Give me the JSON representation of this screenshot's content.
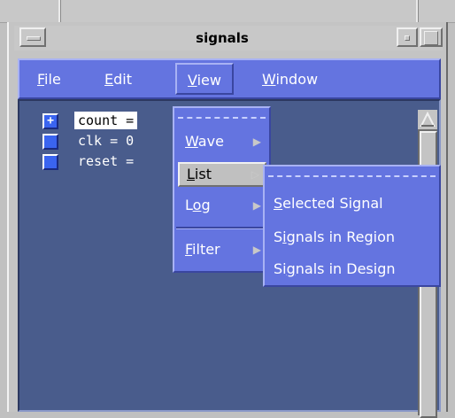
{
  "window": {
    "title": "signals"
  },
  "menubar": {
    "items": [
      {
        "mnemonic": "F",
        "rest": "ile"
      },
      {
        "mnemonic": "E",
        "rest": "dit"
      },
      {
        "mnemonic": "V",
        "rest": "iew"
      },
      {
        "mnemonic": "W",
        "rest": "indow"
      }
    ]
  },
  "signals": [
    {
      "text": "count =",
      "expand_symbol": "+"
    },
    {
      "text": "clk = 0"
    },
    {
      "text": "reset ="
    }
  ],
  "view_menu": {
    "items": [
      {
        "mnemonic": "W",
        "rest": "ave",
        "arrow": "▶"
      },
      {
        "mnemonic": "L",
        "rest": "ist",
        "arrow": "▷"
      },
      {
        "pre": "L",
        "mnemonic": "o",
        "rest": "g",
        "arrow": "▶"
      },
      {
        "mnemonic": "F",
        "rest": "ilter",
        "arrow": "▶"
      }
    ]
  },
  "list_submenu": {
    "items": [
      {
        "pre": "",
        "mnemonic": "S",
        "rest": "elected Signal"
      },
      {
        "pre": "S",
        "mnemonic": "i",
        "rest": "gnals in Region"
      },
      {
        "pre": "Si",
        "mnemonic": "g",
        "rest": "nals in Design"
      }
    ]
  },
  "colors": {
    "menu_blue": "#6474e0",
    "pane_blue": "#495c8c",
    "chrome_gray": "#c4c4c4"
  }
}
